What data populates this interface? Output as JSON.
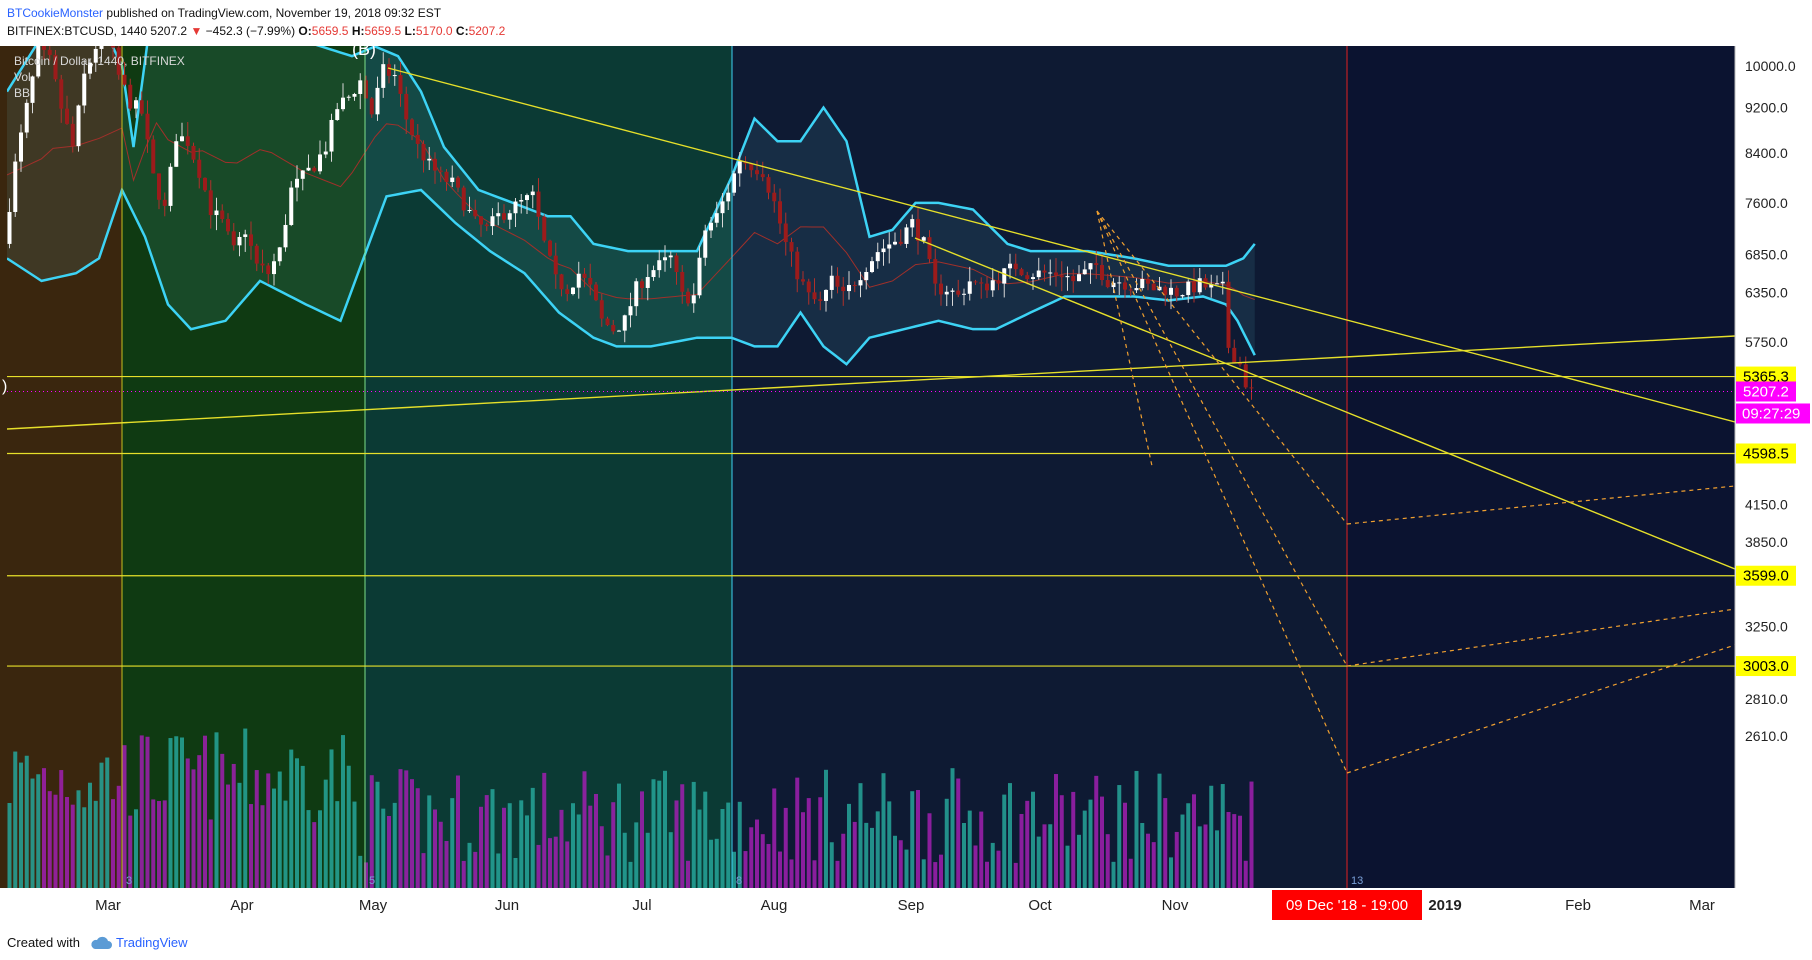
{
  "header": {
    "author": "BTCookieMonster",
    "published": "published on TradingView.com, November 19, 2018 09:32 EST",
    "symbol_line": "BITFINEX:BTCUSD, 1440",
    "price": "5207.2",
    "change": "−452.3 (−7.99%)",
    "open_label": "O:",
    "open": "5659.5",
    "high_label": "H:",
    "high": "5659.5",
    "low_label": "L:",
    "low": "5170.0",
    "close_label": "C:",
    "close": "5207.2"
  },
  "legend": {
    "title": "Bitcoin / Dollar, 1440, BITFINEX",
    "vol": "Vol",
    "bb": "BB"
  },
  "footer": {
    "created_with": "Created with",
    "brand": "TradingView"
  },
  "colors": {
    "candle_up": "#ffffff",
    "candle_down": "#9c1b1b",
    "bollinger": "#3dd3f5",
    "trendline": "#e6e02a",
    "projection": "#f0a030",
    "marker_line": "#e02020",
    "price_label_bg": "#ff00ff",
    "level_label_bg": "#ffff00",
    "vol_up": "#26a69a",
    "vol_down": "#a020b0"
  },
  "chart_data": {
    "type": "candlestick",
    "symbol": "BITFINEX:BTCUSD",
    "interval": "1440",
    "y_scale": "log",
    "ylim": [
      2450,
      10500
    ],
    "y_ticks": [
      "10000.0",
      "9200.0",
      "8400.0",
      "7600.0",
      "6850.0",
      "6350.0",
      "5750.0",
      "4150.0",
      "3850.0",
      "3250.0",
      "2810.0",
      "2610.0"
    ],
    "x_ticks": [
      "Mar",
      "Apr",
      "May",
      "Jun",
      "Jul",
      "Aug",
      "Sep",
      "Oct",
      "Nov",
      "2019",
      "Feb",
      "Mar"
    ],
    "price_levels": [
      {
        "value": "5365.3"
      },
      {
        "value": "4598.5"
      },
      {
        "value": "3599.0"
      },
      {
        "value": "3003.0"
      }
    ],
    "last_price": "5207.2",
    "countdown": "09:27:29",
    "marker_date_label": "09 Dec '18 - 19:00",
    "wave_label": "(B)",
    "zone_labels": [
      "3",
      "5",
      "8",
      "13"
    ],
    "close_path": [
      [
        0,
        7000
      ],
      [
        10,
        8200
      ],
      [
        20,
        9200
      ],
      [
        30,
        10300
      ],
      [
        40,
        10100
      ],
      [
        50,
        9200
      ],
      [
        60,
        8500
      ],
      [
        70,
        9800
      ],
      [
        80,
        10400
      ],
      [
        90,
        10700
      ],
      [
        100,
        9800
      ],
      [
        110,
        9300
      ],
      [
        120,
        9100
      ],
      [
        130,
        8000
      ],
      [
        140,
        7500
      ],
      [
        150,
        8700
      ],
      [
        160,
        8600
      ],
      [
        170,
        8100
      ],
      [
        180,
        7500
      ],
      [
        190,
        7300
      ],
      [
        200,
        6900
      ],
      [
        210,
        7200
      ],
      [
        220,
        6700
      ],
      [
        230,
        6600
      ],
      [
        240,
        6900
      ],
      [
        250,
        7800
      ],
      [
        260,
        8000
      ],
      [
        270,
        8200
      ],
      [
        280,
        8500
      ],
      [
        290,
        9200
      ],
      [
        300,
        9400
      ],
      [
        310,
        9700
      ],
      [
        320,
        9100
      ],
      [
        330,
        9900
      ],
      [
        340,
        9800
      ],
      [
        350,
        9000
      ],
      [
        360,
        8500
      ],
      [
        370,
        8200
      ],
      [
        380,
        8000
      ],
      [
        390,
        7900
      ],
      [
        400,
        7600
      ],
      [
        410,
        7300
      ],
      [
        420,
        7200
      ],
      [
        430,
        7400
      ],
      [
        440,
        7500
      ],
      [
        450,
        7600
      ],
      [
        460,
        7700
      ],
      [
        470,
        7000
      ],
      [
        480,
        6500
      ],
      [
        490,
        6400
      ],
      [
        500,
        6600
      ],
      [
        510,
        6400
      ],
      [
        520,
        6000
      ],
      [
        530,
        5900
      ],
      [
        540,
        6000
      ],
      [
        550,
        6400
      ],
      [
        560,
        6600
      ],
      [
        570,
        6700
      ],
      [
        580,
        6800
      ],
      [
        590,
        6300
      ],
      [
        600,
        6300
      ],
      [
        610,
        7200
      ],
      [
        620,
        7400
      ],
      [
        630,
        7800
      ],
      [
        640,
        8300
      ],
      [
        650,
        8200
      ],
      [
        660,
        8100
      ],
      [
        670,
        7600
      ],
      [
        680,
        7000
      ],
      [
        690,
        6600
      ],
      [
        700,
        6300
      ],
      [
        710,
        6200
      ],
      [
        720,
        6500
      ],
      [
        730,
        6300
      ],
      [
        740,
        6500
      ],
      [
        750,
        6700
      ],
      [
        760,
        6900
      ],
      [
        770,
        7000
      ],
      [
        780,
        7100
      ],
      [
        790,
        7300
      ],
      [
        800,
        7000
      ],
      [
        810,
        6400
      ],
      [
        820,
        6400
      ],
      [
        830,
        6300
      ],
      [
        840,
        6500
      ],
      [
        850,
        6400
      ],
      [
        860,
        6500
      ],
      [
        870,
        6600
      ],
      [
        880,
        6700
      ],
      [
        890,
        6600
      ],
      [
        900,
        6600
      ],
      [
        910,
        6600
      ],
      [
        920,
        6600
      ],
      [
        930,
        6500
      ],
      [
        940,
        6600
      ],
      [
        950,
        6700
      ],
      [
        960,
        6500
      ],
      [
        970,
        6500
      ],
      [
        980,
        6450
      ],
      [
        990,
        6450
      ],
      [
        1000,
        6400
      ],
      [
        1010,
        6400
      ],
      [
        1020,
        6350
      ],
      [
        1030,
        6400
      ],
      [
        1040,
        6450
      ],
      [
        1050,
        6400
      ],
      [
        1060,
        6400
      ],
      [
        1065,
        5700
      ],
      [
        1070,
        5600
      ],
      [
        1075,
        5500
      ],
      [
        1080,
        5300
      ],
      [
        1085,
        5207
      ]
    ],
    "bb_upper": [
      [
        0,
        9500
      ],
      [
        40,
        11000
      ],
      [
        80,
        11000
      ],
      [
        100,
        10000
      ],
      [
        110,
        8500
      ],
      [
        130,
        12000
      ],
      [
        170,
        12000
      ],
      [
        200,
        11000
      ],
      [
        230,
        11000
      ],
      [
        260,
        10500
      ],
      [
        300,
        10200
      ],
      [
        320,
        10400
      ],
      [
        340,
        10200
      ],
      [
        360,
        9500
      ],
      [
        380,
        8500
      ],
      [
        410,
        7800
      ],
      [
        440,
        7600
      ],
      [
        470,
        7400
      ],
      [
        490,
        7400
      ],
      [
        510,
        7000
      ],
      [
        540,
        6900
      ],
      [
        570,
        6900
      ],
      [
        600,
        6900
      ],
      [
        630,
        8000
      ],
      [
        650,
        9000
      ],
      [
        670,
        8600
      ],
      [
        690,
        8600
      ],
      [
        710,
        9200
      ],
      [
        730,
        8600
      ],
      [
        750,
        7100
      ],
      [
        770,
        7200
      ],
      [
        790,
        7600
      ],
      [
        810,
        7600
      ],
      [
        840,
        7500
      ],
      [
        870,
        7000
      ],
      [
        890,
        6900
      ],
      [
        910,
        6900
      ],
      [
        940,
        6900
      ],
      [
        980,
        6800
      ],
      [
        1010,
        6700
      ],
      [
        1040,
        6700
      ],
      [
        1060,
        6700
      ],
      [
        1075,
        6800
      ],
      [
        1085,
        7000
      ]
    ],
    "bb_lower": [
      [
        0,
        6800
      ],
      [
        30,
        6500
      ],
      [
        60,
        6600
      ],
      [
        80,
        6800
      ],
      [
        100,
        7800
      ],
      [
        120,
        7100
      ],
      [
        140,
        6200
      ],
      [
        160,
        5900
      ],
      [
        190,
        6000
      ],
      [
        220,
        6500
      ],
      [
        260,
        6200
      ],
      [
        290,
        6000
      ],
      [
        310,
        6800
      ],
      [
        330,
        7700
      ],
      [
        360,
        7800
      ],
      [
        390,
        7300
      ],
      [
        420,
        6900
      ],
      [
        450,
        6600
      ],
      [
        480,
        6100
      ],
      [
        510,
        5800
      ],
      [
        530,
        5700
      ],
      [
        560,
        5700
      ],
      [
        600,
        5800
      ],
      [
        630,
        5800
      ],
      [
        650,
        5700
      ],
      [
        670,
        5700
      ],
      [
        690,
        6100
      ],
      [
        710,
        5700
      ],
      [
        730,
        5500
      ],
      [
        750,
        5800
      ],
      [
        780,
        5900
      ],
      [
        810,
        6000
      ],
      [
        840,
        5900
      ],
      [
        860,
        5900
      ],
      [
        890,
        6100
      ],
      [
        920,
        6300
      ],
      [
        950,
        6300
      ],
      [
        980,
        6300
      ],
      [
        1010,
        6250
      ],
      [
        1040,
        6300
      ],
      [
        1060,
        6200
      ],
      [
        1070,
        6000
      ],
      [
        1085,
        5600
      ]
    ]
  }
}
